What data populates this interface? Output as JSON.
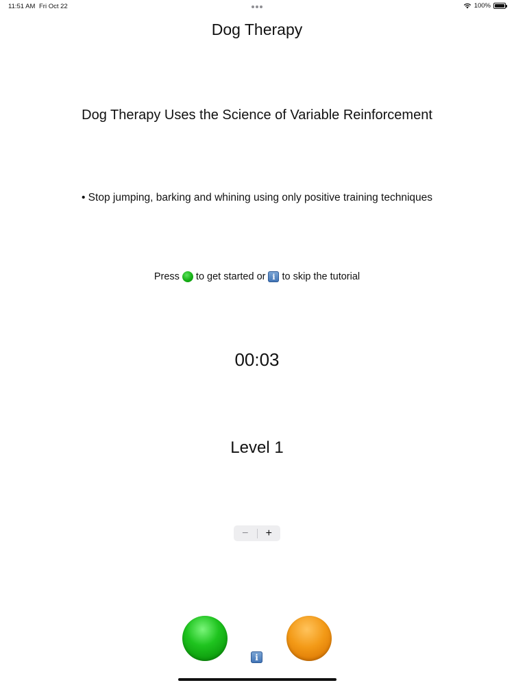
{
  "status_bar": {
    "time": "11:51 AM",
    "date": "Fri Oct 22",
    "battery_percent": "100%",
    "battery_level": 1.0
  },
  "nav": {
    "title": "Dog Therapy"
  },
  "main": {
    "heading": "Dog Therapy Uses the Science of Variable Reinforcement",
    "bullet": "• Stop jumping, barking and whining using only positive training techniques",
    "instruction": {
      "prefix": "Press",
      "middle": "to get started or",
      "suffix": "to skip the tutorial",
      "info_glyph": "i"
    },
    "timer": "00:03",
    "level": "Level 1"
  },
  "stepper": {
    "minus_label": "−",
    "plus_label": "+"
  },
  "controls": {
    "green_color": "#16b116",
    "orange_color": "#f39a17",
    "info_glyph": "i"
  },
  "icons": {
    "wifi": "wifi-icon",
    "battery": "battery-icon",
    "green_dot": "green-circle-icon",
    "info": "info-icon"
  }
}
